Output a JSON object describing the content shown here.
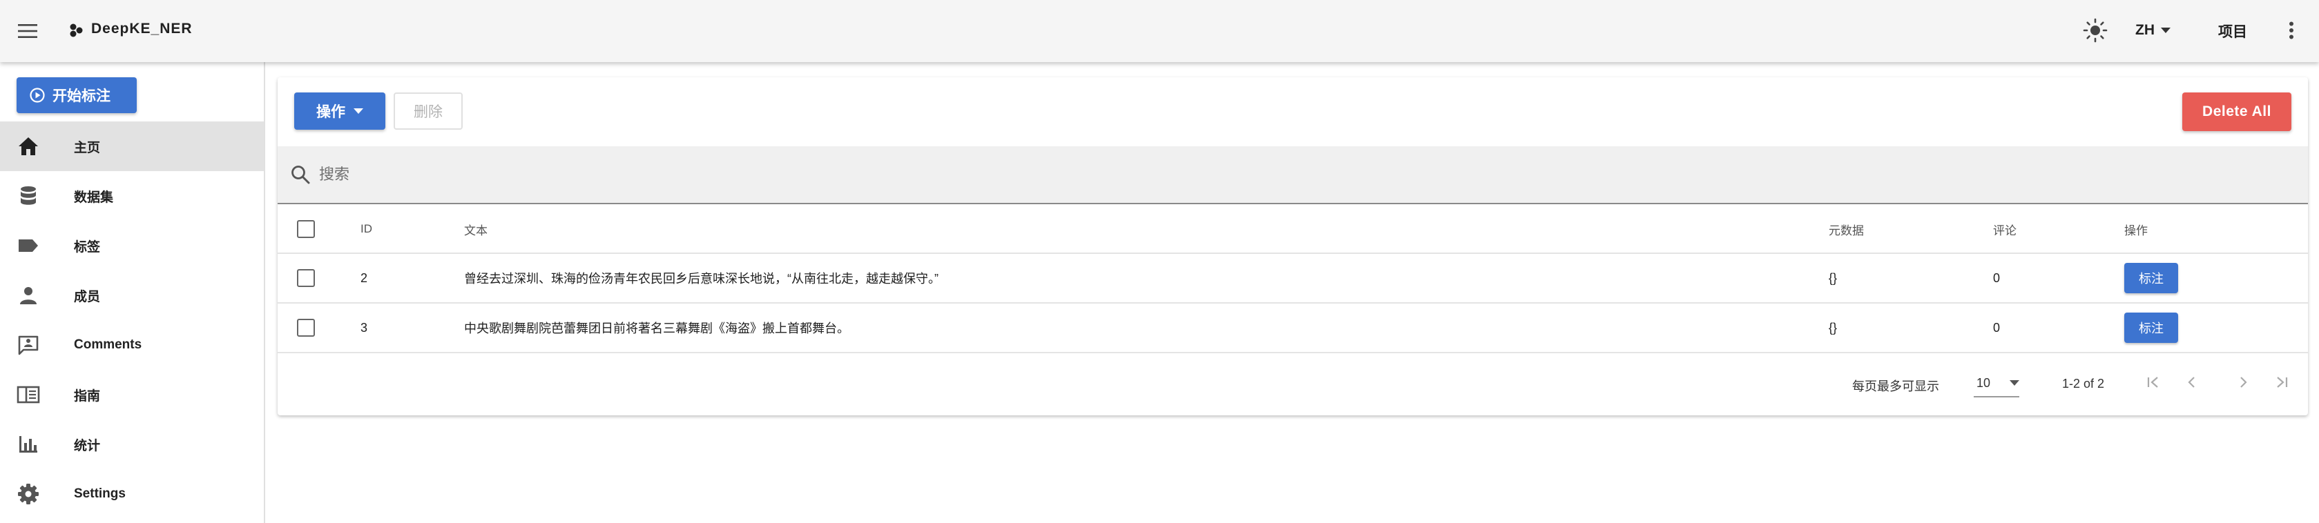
{
  "app": {
    "title": "DeepKE_NER"
  },
  "topbar": {
    "lang_label": "ZH",
    "projects_label": "项目"
  },
  "sidebar": {
    "start_label": "开始标注",
    "items": [
      {
        "label": "主页",
        "icon": "home-icon",
        "active": true
      },
      {
        "label": "数据集",
        "icon": "database-icon",
        "active": false
      },
      {
        "label": "标签",
        "icon": "label-icon",
        "active": false
      },
      {
        "label": "成员",
        "icon": "person-icon",
        "active": false
      },
      {
        "label": "Comments",
        "icon": "comment-icon",
        "active": false
      },
      {
        "label": "指南",
        "icon": "book-icon",
        "active": false
      },
      {
        "label": "统计",
        "icon": "chart-icon",
        "active": false
      },
      {
        "label": "Settings",
        "icon": "gear-icon",
        "active": false
      }
    ]
  },
  "toolbar": {
    "actions_label": "操作",
    "delete_label": "删除",
    "delete_all_label": "Delete All"
  },
  "search": {
    "placeholder": "搜索",
    "value": ""
  },
  "table": {
    "headers": {
      "id": "ID",
      "text": "文本",
      "metadata": "元数据",
      "comments": "评论",
      "actions": "操作"
    },
    "rows": [
      {
        "id": "2",
        "text": "曾经去过深圳、珠海的俭汤青年农民回乡后意味深长地说，“从南往北走，越走越保守。”",
        "metadata": "{}",
        "comments": "0",
        "action_label": "标注"
      },
      {
        "id": "3",
        "text": "中央歌剧舞剧院芭蕾舞团日前将著名三幕舞剧《海盗》搬上首都舞台。",
        "metadata": "{}",
        "comments": "0",
        "action_label": "标注"
      }
    ]
  },
  "pagination": {
    "rows_per_page_label": "每页最多可显示",
    "rows_per_page": "10",
    "range": "1-2 of 2"
  },
  "colors": {
    "primary": "#3d74d0",
    "danger": "#e85c55",
    "appbar": "#f5f5f5",
    "active_nav": "#e2e2e2"
  }
}
